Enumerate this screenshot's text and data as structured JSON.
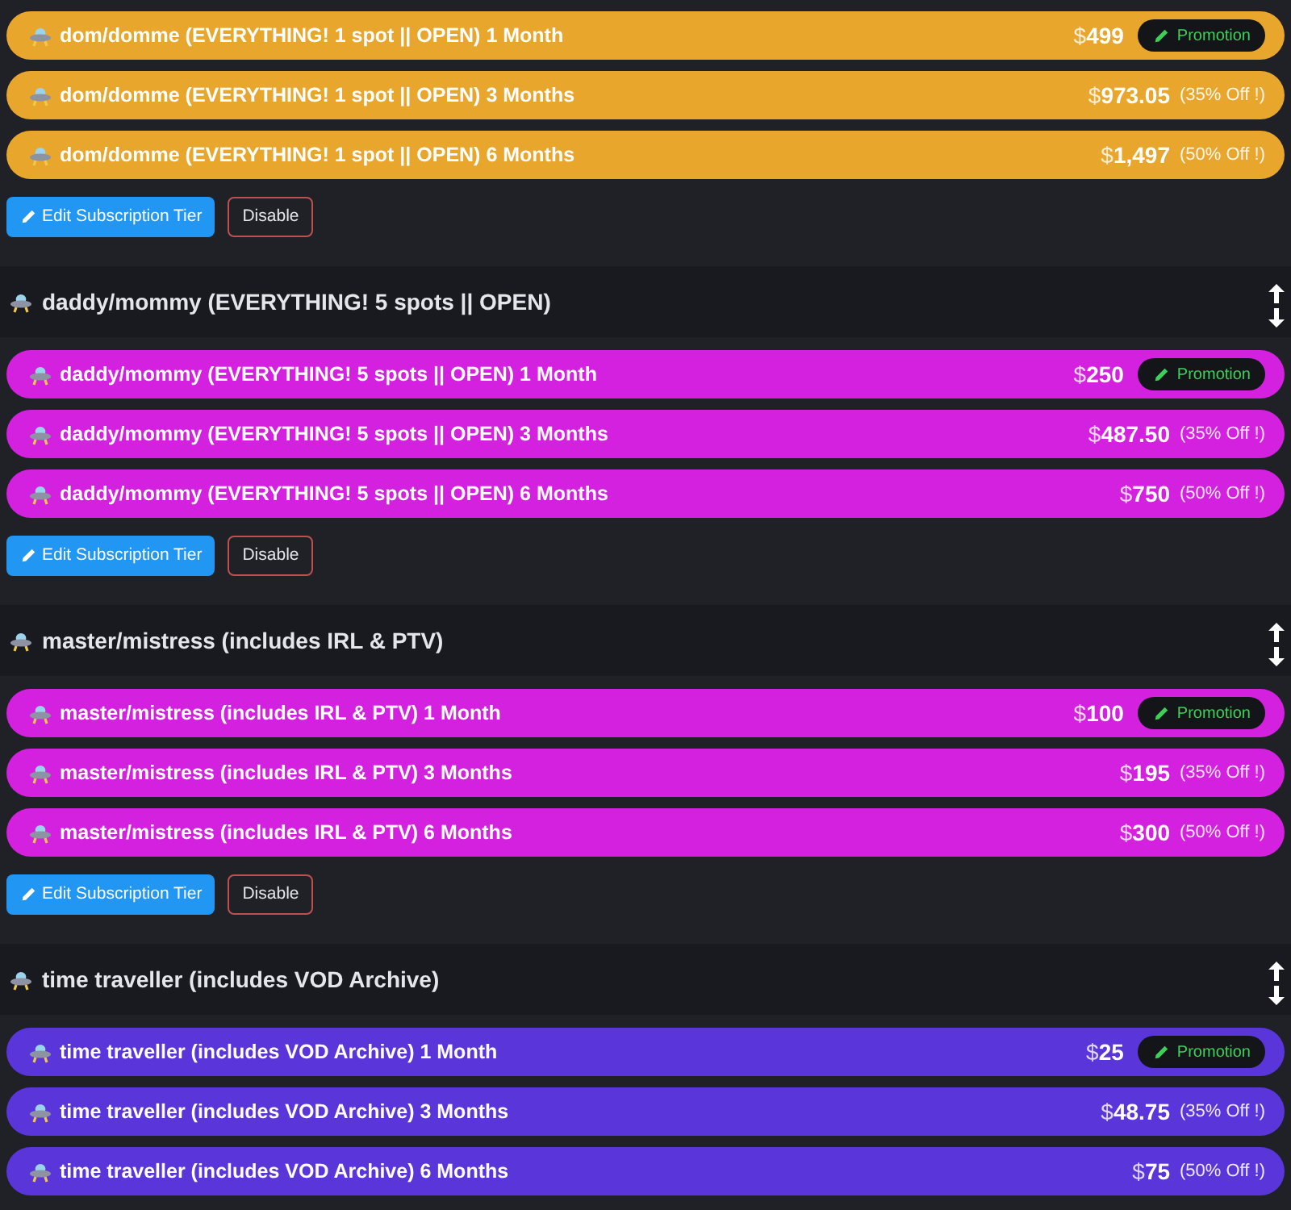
{
  "sections": [
    {
      "color": "#e9a62d",
      "tiers": [
        {
          "label": "dom/domme (EVERYTHING! 1 spot || OPEN) 1 Month",
          "currency": "$",
          "amount": "499",
          "promotion": "Promotion"
        },
        {
          "label": "dom/domme (EVERYTHING! 1 spot || OPEN) 3 Months",
          "currency": "$",
          "amount": "973.05",
          "discount": "(35% Off !)"
        },
        {
          "label": "dom/domme (EVERYTHING! 1 spot || OPEN) 6 Months",
          "currency": "$",
          "amount": "1,497",
          "discount": "(50% Off !)"
        }
      ],
      "actions": {
        "edit": "Edit Subscription Tier",
        "disable": "Disable"
      }
    },
    {
      "title": "daddy/mommy (EVERYTHING! 5 spots || OPEN)",
      "color": "#d321df",
      "tiers": [
        {
          "label": "daddy/mommy (EVERYTHING! 5 spots || OPEN) 1 Month",
          "currency": "$",
          "amount": "250",
          "promotion": "Promotion"
        },
        {
          "label": "daddy/mommy (EVERYTHING! 5 spots || OPEN) 3 Months",
          "currency": "$",
          "amount": "487.50",
          "discount": "(35% Off !)"
        },
        {
          "label": "daddy/mommy (EVERYTHING! 5 spots || OPEN) 6 Months",
          "currency": "$",
          "amount": "750",
          "discount": "(50% Off !)"
        }
      ],
      "actions": {
        "edit": "Edit Subscription Tier",
        "disable": "Disable"
      }
    },
    {
      "title": "master/mistress (includes IRL & PTV)",
      "color": "#d321df",
      "tiers": [
        {
          "label": "master/mistress (includes IRL & PTV) 1 Month",
          "currency": "$",
          "amount": "100",
          "promotion": "Promotion"
        },
        {
          "label": "master/mistress (includes IRL & PTV) 3 Months",
          "currency": "$",
          "amount": "195",
          "discount": "(35% Off !)"
        },
        {
          "label": "master/mistress (includes IRL & PTV) 6 Months",
          "currency": "$",
          "amount": "300",
          "discount": "(50% Off !)"
        }
      ],
      "actions": {
        "edit": "Edit Subscription Tier",
        "disable": "Disable"
      }
    },
    {
      "title": "time traveller (includes VOD Archive)",
      "color": "#5a36da",
      "tiers": [
        {
          "label": "time traveller (includes VOD Archive) 1 Month",
          "currency": "$",
          "amount": "25",
          "promotion": "Promotion"
        },
        {
          "label": "time traveller (includes VOD Archive) 3 Months",
          "currency": "$",
          "amount": "48.75",
          "discount": "(35% Off !)"
        },
        {
          "label": "time traveller (includes VOD Archive) 6 Months",
          "currency": "$",
          "amount": "75",
          "discount": "(50% Off !)"
        }
      ]
    }
  ]
}
